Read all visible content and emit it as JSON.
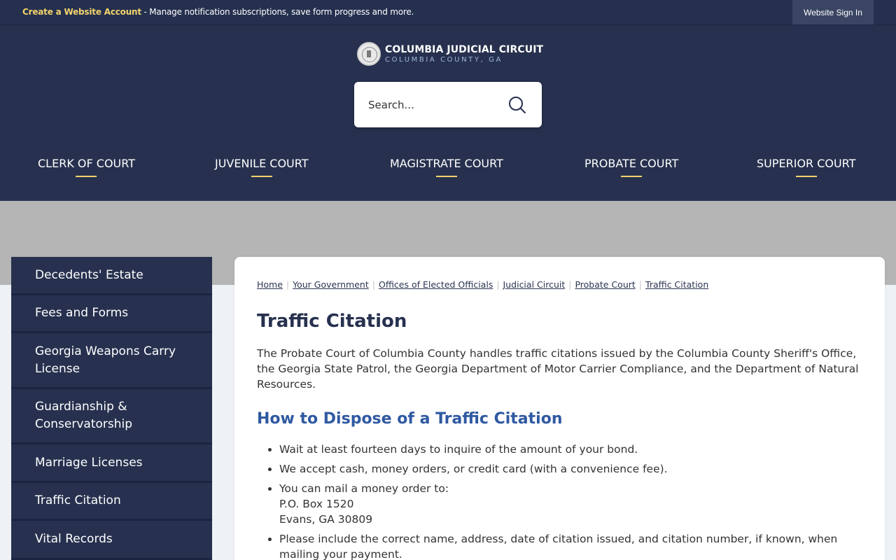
{
  "topbar": {
    "account_link": "Create a Website Account",
    "account_text": " - Manage notification subscriptions, save form progress and more.",
    "signin": "Website Sign In"
  },
  "logo": {
    "title": "COLUMBIA JUDICIAL CIRCUIT",
    "subtitle": "COLUMBIA COUNTY, GA"
  },
  "search": {
    "placeholder": "Search..."
  },
  "nav": [
    "CLERK OF COURT",
    "JUVENILE COURT",
    "MAGISTRATE COURT",
    "PROBATE COURT",
    "SUPERIOR COURT"
  ],
  "sidebar": [
    "Decedents' Estate",
    "Fees and Forms",
    "Georgia Weapons Carry License",
    "Guardianship & Conservatorship",
    "Marriage Licenses",
    "Traffic Citation",
    "Vital Records"
  ],
  "breadcrumbs": [
    "Home",
    "Your Government",
    "Offices of Elected Officials",
    "Judicial Circuit",
    "Probate Court",
    "Traffic Citation"
  ],
  "page": {
    "title": "Traffic Citation",
    "intro": "The Probate Court of Columbia County handles traffic citations issued by the Columbia County Sheriff's Office, the Georgia State Patrol, the Georgia Department of Motor Carrier Compliance, and the Department of Natural Resources.",
    "subheading": "How to Dispose of a Traffic Citation",
    "bullets": [
      "Wait at least fourteen days to inquire of the amount of your bond.",
      "We accept cash, money orders, or credit card (with a convenience fee).",
      "You can mail a money order to:",
      "Please include the correct name, address, date of citation issued, and citation number, if known, when mailing your payment."
    ],
    "mail_address": [
      "P.O. Box 1520",
      "Evans, GA 30809"
    ]
  }
}
